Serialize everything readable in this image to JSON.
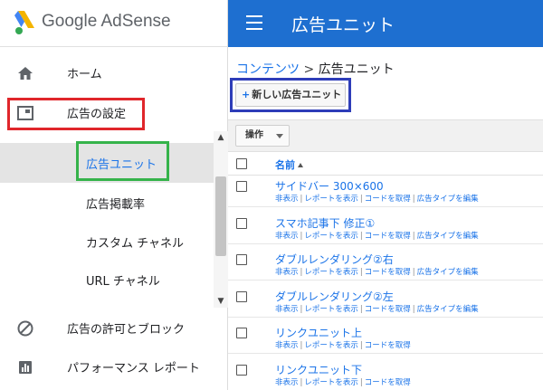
{
  "brand": {
    "name": "Google AdSense"
  },
  "sidebar": {
    "items": [
      {
        "label": "ホーム",
        "icon": "home-icon"
      },
      {
        "label": "広告の設定",
        "icon": "ad-settings-icon"
      },
      {
        "label": "広告の許可とブロック",
        "icon": "block-icon"
      },
      {
        "label": "パフォーマンス レポート",
        "icon": "bar-chart-icon"
      }
    ],
    "subitems": [
      {
        "label": "広告ユニット",
        "active": true
      },
      {
        "label": "広告掲載率"
      },
      {
        "label": "カスタム チャネル"
      },
      {
        "label": "URL チャネル"
      }
    ]
  },
  "appbar": {
    "title": "広告ユニット"
  },
  "breadcrumb": {
    "parent": "コンテンツ",
    "separator": ">",
    "current": "広告ユニット"
  },
  "toolbar": {
    "new_unit_label": "新しい広告ユニット",
    "action_label": "操作"
  },
  "table": {
    "header": "名前",
    "rows": [
      {
        "name": "サイドバー 300×600",
        "actions": [
          "非表示",
          "レポートを表示",
          "コードを取得",
          "広告タイプを編集"
        ]
      },
      {
        "name": "スマホ記事下 修正①",
        "actions": [
          "非表示",
          "レポートを表示",
          "コードを取得",
          "広告タイプを編集"
        ]
      },
      {
        "name": "ダブルレンダリング②右",
        "actions": [
          "非表示",
          "レポートを表示",
          "コードを取得",
          "広告タイプを編集"
        ]
      },
      {
        "name": "ダブルレンダリング②左",
        "actions": [
          "非表示",
          "レポートを表示",
          "コードを取得",
          "広告タイプを編集"
        ]
      },
      {
        "name": "リンクユニット上",
        "actions": [
          "非表示",
          "レポートを表示",
          "コードを取得"
        ]
      },
      {
        "name": "リンクユニット下",
        "actions": [
          "非表示",
          "レポートを表示",
          "コードを取得"
        ]
      }
    ]
  },
  "colors": {
    "appbar": "#1e6fd0",
    "link": "#1a73e8",
    "highlight_red": "#e0262b",
    "highlight_green": "#35b34a",
    "highlight_blue": "#2e3db8"
  }
}
